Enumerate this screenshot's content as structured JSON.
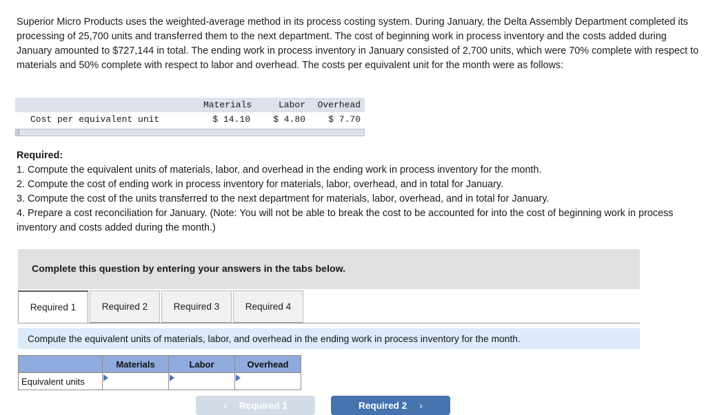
{
  "problem": {
    "paragraph": "Superior Micro Products uses the weighted-average method in its process costing system. During January, the Delta Assembly Department completed its processing of 25,700 units and transferred them to the next department. The cost of beginning work in process inventory and the costs added during January amounted to $727,144 in total. The ending work in process inventory in January consisted of 2,700 units, which were 70% complete with respect to materials and 50% complete with respect to labor and overhead. The costs per equivalent unit for the month were as follows:"
  },
  "cost_table": {
    "headers": [
      "",
      "Materials",
      "Labor",
      "Overhead"
    ],
    "row_label": "Cost per equivalent unit",
    "values": [
      "$ 14.10",
      "$ 4.80",
      "$ 7.70"
    ]
  },
  "required": {
    "title": "Required:",
    "items": [
      "1. Compute the equivalent units of materials, labor, and overhead in the ending work in process inventory for the month.",
      "2. Compute the cost of ending work in process inventory for materials, labor, overhead, and in total for January.",
      "3. Compute the cost of the units transferred to the next department for materials, labor, overhead, and in total for January.",
      "4. Prepare a cost reconciliation for January. (Note: You will not be able to break the cost to be accounted for into the cost of beginning work in process inventory and costs added during the month.)"
    ]
  },
  "instruction_banner": {
    "text": "Complete this question by entering your answers in the tabs below."
  },
  "tabs": [
    {
      "label": "Required 1",
      "active": true
    },
    {
      "label": "Required 2",
      "active": false
    },
    {
      "label": "Required 3",
      "active": false
    },
    {
      "label": "Required 4",
      "active": false
    }
  ],
  "prompt_bar": {
    "text": "Compute the equivalent units of materials, labor, and overhead in the ending work in process inventory for the month."
  },
  "answer_table": {
    "headers": [
      "",
      "Materials",
      "Labor",
      "Overhead"
    ],
    "rows": [
      {
        "label": "Equivalent units",
        "materials": "",
        "labor": "",
        "overhead": ""
      }
    ]
  },
  "nav": {
    "prev_label": "Required 1",
    "prev_chevron": "‹",
    "next_label": "Required 2",
    "next_chevron": "›"
  },
  "colors": {
    "header_blue": "#8faadc",
    "prompt_blue": "#dceafa",
    "banner_gray": "#e0e0e0",
    "next_button_blue": "#4573ae",
    "prev_button_gray": "#d3dce6",
    "cost_header_gray": "#dde2ea",
    "marker_blue": "#4a77bb"
  }
}
